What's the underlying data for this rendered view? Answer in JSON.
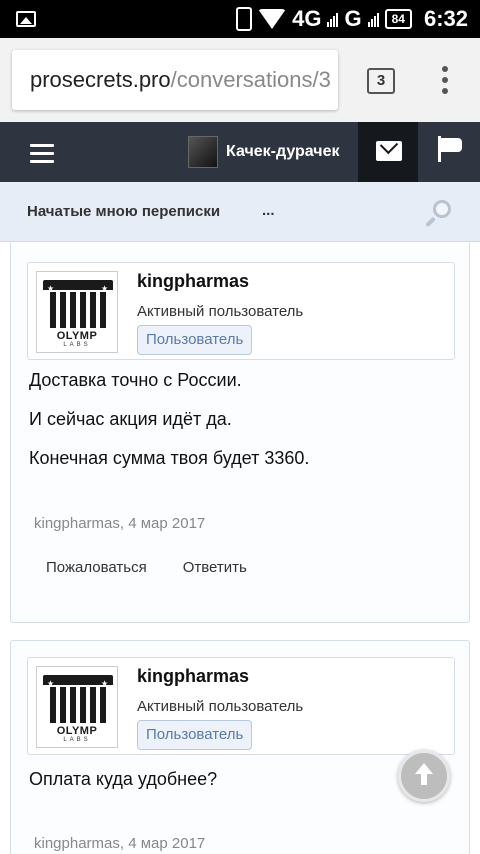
{
  "status_bar": {
    "network": "4G",
    "network2": "G",
    "battery": "84",
    "time": "6:32"
  },
  "browser": {
    "url_host": "prosecrets.pro",
    "url_path": "/conversations/3",
    "tab_count": "3"
  },
  "site_nav": {
    "username": "Качек-дурачек"
  },
  "sub_nav": {
    "title": "Начатые мною переписки",
    "more": "..."
  },
  "messages": [
    {
      "author": "kingpharmas",
      "user_title": "Активный пользователь",
      "user_badge": "Пользователь",
      "avatar_brand": "OLYMP",
      "avatar_sub": "LABS",
      "lines": [
        "Доставка точно с России.",
        "И сейчас акция идёт да.",
        "Конечная сумма твоя будет 3360."
      ],
      "meta": "kingpharmas, 4 мар 2017",
      "report_label": "Пожаловаться",
      "reply_label": "Ответить"
    },
    {
      "author": "kingpharmas",
      "user_title": "Активный пользователь",
      "user_badge": "Пользователь",
      "avatar_brand": "OLYMP",
      "avatar_sub": "LABS",
      "lines": [
        "Оплата куда удобнее?"
      ],
      "meta": "kingpharmas, 4 мар 2017"
    }
  ]
}
